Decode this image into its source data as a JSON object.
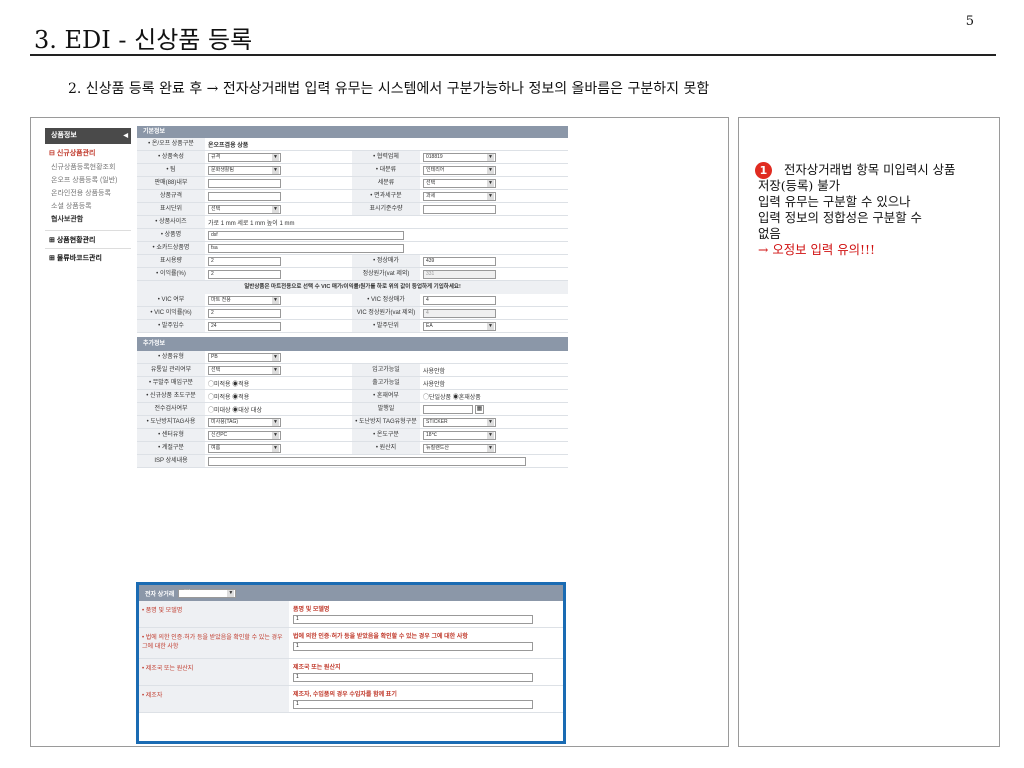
{
  "title": "3. EDI - 신상품 등록",
  "page_no": "5",
  "subtitle": "2. 신상품 등록 완료 후 → 전자상거래법 입력 유무는 시스템에서 구분가능하나 정보의 올바름은 구분하지 못함",
  "note": {
    "num": "1",
    "line1": "전자상거래법 항목 미입력시 상품",
    "line2": "저장(등록) 불가",
    "line3": "입력 유무는 구분할 수 있으나",
    "line4": "입력 정보의 정합성은 구분할 수",
    "line5": "없음",
    "line6": "→ 오정보 입력 유의!!!"
  },
  "sidebar": {
    "header": "상품정보",
    "g1": "신규상품관리",
    "i1": "신규상품등록현황조회",
    "i2": "온오프 상품등록 (일반)",
    "i3": "온라인전용 상품등록",
    "i4": "소셜 상품등록",
    "i5": "협사보관함",
    "g2": "상품현황관리",
    "g3": "물류바코드관리"
  },
  "basic": {
    "section": "기본정보",
    "r0": {
      "l": "온/오프 상품구분",
      "v": "온오프겸용 상품"
    },
    "r1": {
      "l": "상품속성",
      "v": "규격",
      "l2": "협력업체",
      "v2": "018819"
    },
    "r2": {
      "l": "팀",
      "v": "문화생활팀",
      "l2": "대분류",
      "v2": "인테리어"
    },
    "r3": {
      "l": "판매(88)내부",
      "v": "",
      "l2": "세분류",
      "v2": "선택"
    },
    "r4": {
      "l": "상품규격",
      "v": "",
      "l2": "면과세구분",
      "v2": "과세"
    },
    "r5": {
      "l": "표시단위",
      "v": "선택",
      "l2": "표시기준수량",
      "v2": ""
    },
    "r6": {
      "l": "상품사이즈",
      "v": "가로 1 mm 세로 1 mm 높이 1 mm"
    },
    "r7": {
      "l": "상품명",
      "v": "dsf"
    },
    "r8": {
      "l": "쇼카드상품명",
      "v": "fsa"
    },
    "r9": {
      "l": "표시용량",
      "v": "2",
      "l2": "정상매가",
      "v2": "439"
    },
    "r10": {
      "l": "이익률(%)",
      "v": "2",
      "l2": "정상원가(vat 제외)",
      "v2": "331"
    },
    "notice": "일반상품은 마트전용으로 선택 수 VIC 매가/이익률/원가를 하로 위의 값이 등업하게 기입하세요!",
    "r11": {
      "l": "VIC 여부",
      "v": "마트 전용",
      "l2": "VIC 정상매가",
      "v2": "4"
    },
    "r12": {
      "l": "VIC 이익률(%)",
      "v": "2",
      "l2": "VIC 정상원가(vat 제외)",
      "v2": "4"
    },
    "r13": {
      "l": "발주입수",
      "v": "24",
      "l2": "발주단위",
      "v2": "EA"
    }
  },
  "extra": {
    "section": "추가정보",
    "r1": {
      "l": "상품유형",
      "v": "PB"
    },
    "r2": {
      "l": "유통일 관리여부",
      "v": "선택",
      "l2": "입고가능일",
      "v2": "사용안함"
    },
    "r3": {
      "l": "무발주 매입구분",
      "v": "◯미적용 ◉적용",
      "l2": "출고가능일",
      "v2": "사용안함"
    },
    "r4": {
      "l": "신규상품 초도구분",
      "v": "◯미적용 ◉적용",
      "l2": "혼재여부",
      "v2": "◯단일상품 ◉혼재상품"
    },
    "r5": {
      "l": "전수검사여부",
      "v": "◯미대상 ◉대상 대상",
      "l2": "발행일",
      "v2": ""
    },
    "r6": {
      "l": "도난방지TAG사용",
      "v": "미사용(TAG)",
      "l2": "도난방지 TAG유형구분",
      "v2": "STICKER"
    },
    "r7": {
      "l": "센터유형",
      "v": "신선PC",
      "l2": "온도구분",
      "v2": "18℃"
    },
    "r8": {
      "l": "계절구분",
      "v": "여름",
      "l2": "원산지",
      "v2": "뉴질랜드산"
    },
    "r9": {
      "l": "ISP 상세내용",
      "v": ""
    }
  },
  "ecom": {
    "header": "전자 상거래",
    "select": "기타",
    "rows": [
      {
        "l": "품명 및 모델명",
        "h": "품명 및 모델명",
        "v": "1"
      },
      {
        "l": "법에 의한 인증·허가 등을 받았음을 확인할 수 있는 경우 그에 대한 사항",
        "h": "법에 의한 인증·허가 등을 받았음을 확인할 수 있는 경우 그에 대한 사항",
        "v": "1"
      },
      {
        "l": "제조국 또는 원산지",
        "h": "제조국 또는 원산지",
        "v": "1"
      },
      {
        "l": "제조자",
        "h": "제조자, 수입품의 경우 수입자를 함께 표기",
        "v": "1"
      }
    ]
  }
}
